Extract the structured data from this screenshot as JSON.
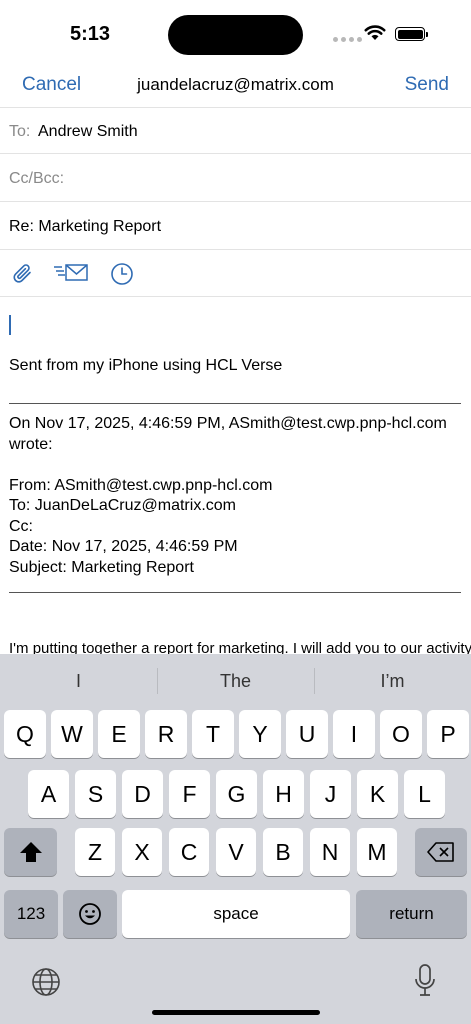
{
  "status": {
    "time": "5:13"
  },
  "nav": {
    "cancel": "Cancel",
    "title": "juandelacruz@matrix.com",
    "send": "Send"
  },
  "to": {
    "label": "To:",
    "value": "Andrew Smith"
  },
  "cc": {
    "label": "Cc/Bcc:"
  },
  "subject": {
    "value": "Re: Marketing Report"
  },
  "body": {
    "signature": "Sent from my iPhone using HCL Verse",
    "quote_header_1": "On Nov 17, 2025, 4:46:59 PM, ASmith@test.cwp.pnp-hcl.com",
    "quote_header_2": "wrote:",
    "from": "From: ASmith@test.cwp.pnp-hcl.com",
    "to": "To: JuanDeLaCruz@matrix.com",
    "cc": "Cc:",
    "date": "Date: Nov 17, 2025, 4:46:59 PM",
    "subject": "Subject: Marketing Report",
    "message": "I'm putting together a report for marketing. I will add you to our activity to"
  },
  "keyboard": {
    "suggestions": [
      "I",
      "The",
      "I’m"
    ],
    "row1": [
      "Q",
      "W",
      "E",
      "R",
      "T",
      "Y",
      "U",
      "I",
      "O",
      "P"
    ],
    "row2": [
      "A",
      "S",
      "D",
      "F",
      "G",
      "H",
      "J",
      "K",
      "L"
    ],
    "row3": [
      "Z",
      "X",
      "C",
      "V",
      "B",
      "N",
      "M"
    ],
    "numbers": "123",
    "space": "space",
    "return": "return"
  },
  "colors": {
    "accent": "#2f6bb3",
    "keyboard_bg": "#d3d5db"
  }
}
